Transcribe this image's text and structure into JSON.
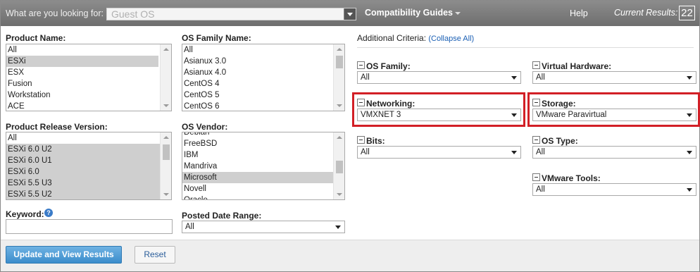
{
  "topbar": {
    "search_label": "What are you looking for:",
    "search_value": "Guest OS",
    "guides_label": "Compatibility Guides",
    "help_label": "Help",
    "results_label": "Current Results:",
    "results_count": "22"
  },
  "product_name": {
    "label": "Product Name:",
    "items": [
      "All",
      "ESXi",
      "ESX",
      "Fusion",
      "Workstation",
      "ACE"
    ],
    "selected": [
      "ESXi"
    ]
  },
  "os_family_name": {
    "label": "OS Family Name:",
    "items": [
      "All",
      "Asianux 3.0",
      "Asianux 4.0",
      "CentOS 4",
      "CentOS 5",
      "CentOS 6"
    ]
  },
  "product_release": {
    "label": "Product Release Version:",
    "items": [
      "All",
      "ESXi 6.0 U2",
      "ESXi 6.0 U1",
      "ESXi 6.0",
      "ESXi 5.5 U3",
      "ESXi 5.5 U2"
    ],
    "selected": [
      "ESXi 6.0 U2",
      "ESXi 6.0 U1",
      "ESXi 6.0",
      "ESXi 5.5 U3",
      "ESXi 5.5 U2"
    ]
  },
  "os_vendor": {
    "label": "OS Vendor:",
    "items": [
      "Debian",
      "FreeBSD",
      "IBM",
      "Mandriva",
      "Microsoft",
      "Novell",
      "Oracle"
    ],
    "selected": [
      "Microsoft"
    ]
  },
  "keyword": {
    "label": "Keyword:",
    "value": "",
    "info_icon": "info-icon"
  },
  "posted_date": {
    "label": "Posted Date Range:",
    "value": "All"
  },
  "criteria": {
    "heading": "Additional Criteria:",
    "collapse_link": "(Collapse All)",
    "os_family": {
      "label": "OS Family:",
      "value": "All"
    },
    "virtual_hardware": {
      "label": "Virtual Hardware:",
      "value": "All"
    },
    "networking": {
      "label": "Networking:",
      "value": "VMXNET 3"
    },
    "storage": {
      "label": "Storage:",
      "value": "VMware Paravirtual"
    },
    "bits": {
      "label": "Bits:",
      "value": "All"
    },
    "os_type": {
      "label": "OS Type:",
      "value": "All"
    },
    "vmware_tools": {
      "label": "VMware Tools:",
      "value": "All"
    }
  },
  "footer": {
    "update_button": "Update and View Results",
    "reset_button": "Reset"
  },
  "colors": {
    "highlight_border": "#d21f26",
    "primary_button": "#3b8dcc",
    "topbar": "#7a7a7a"
  }
}
